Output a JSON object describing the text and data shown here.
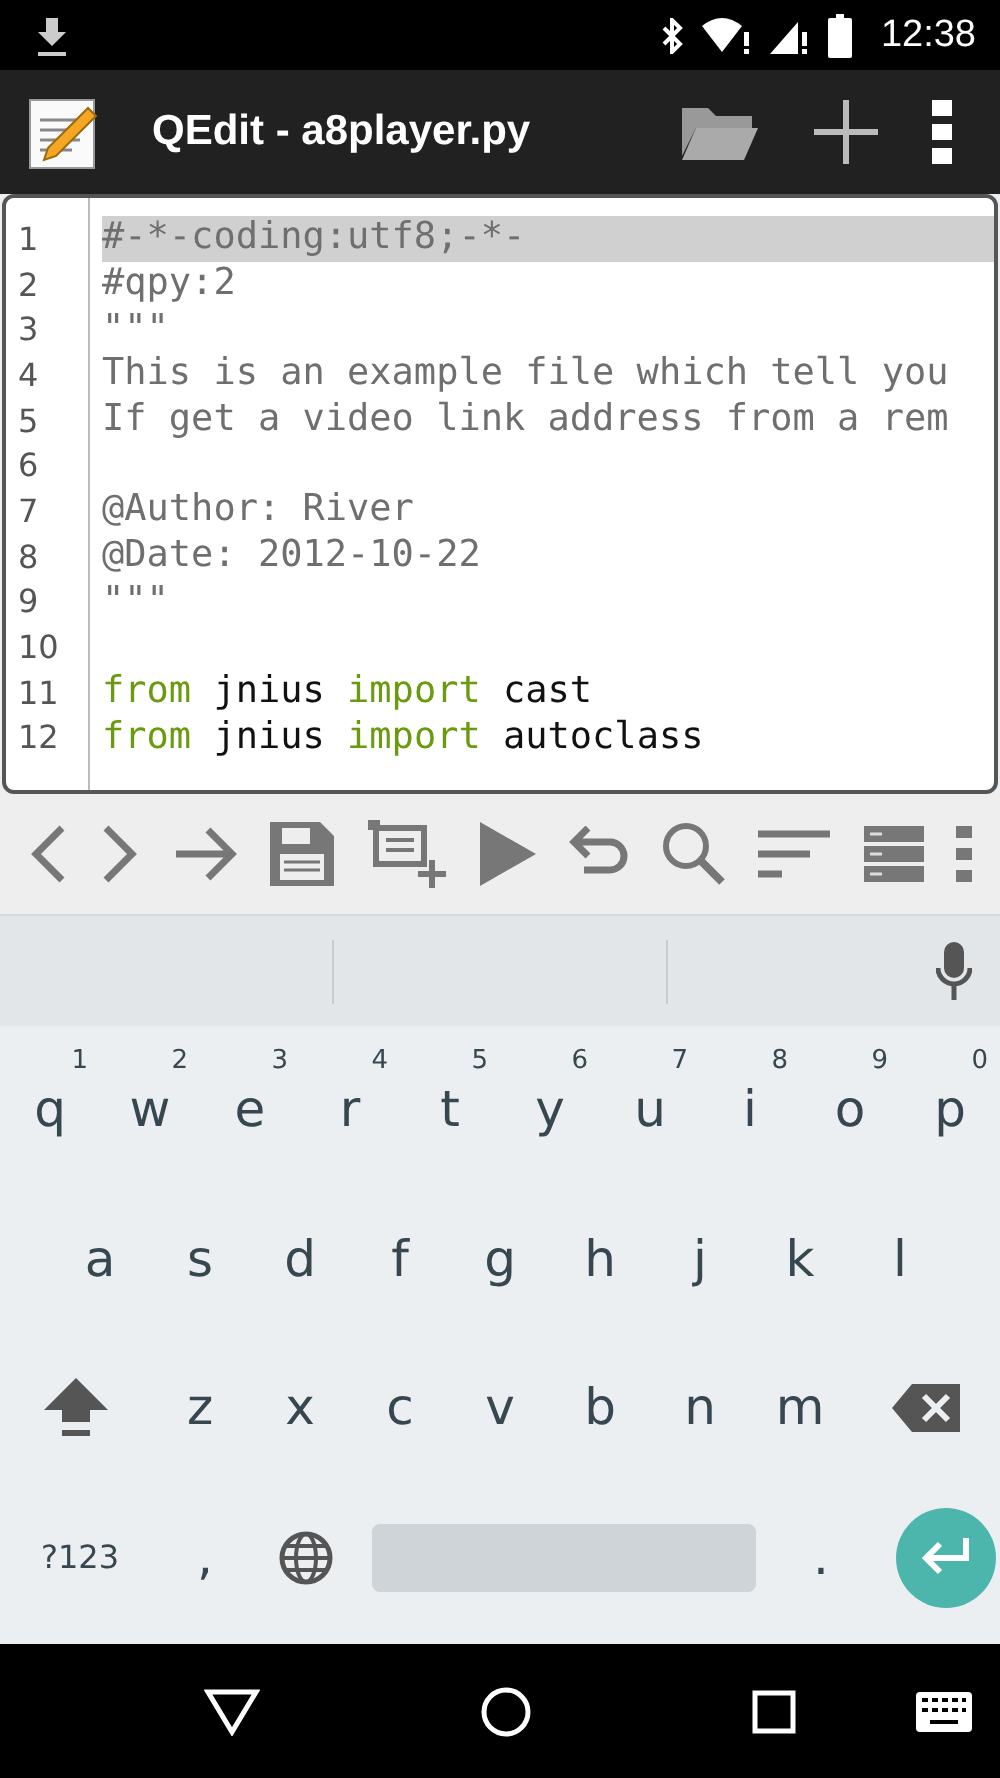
{
  "status_bar": {
    "time": "12:38"
  },
  "app_bar": {
    "title": "QEdit - a8player.py"
  },
  "editor": {
    "lines": [
      {
        "number": "1",
        "highlighted": true,
        "tokens": [
          {
            "text": "#-*-coding:utf8;-*-",
            "kind": "comment"
          }
        ]
      },
      {
        "number": "2",
        "highlighted": false,
        "tokens": [
          {
            "text": "#qpy:2",
            "kind": "comment"
          }
        ]
      },
      {
        "number": "3",
        "highlighted": false,
        "tokens": [
          {
            "text": "\"\"\"",
            "kind": "comment"
          }
        ]
      },
      {
        "number": "4",
        "highlighted": false,
        "tokens": [
          {
            "text": "This is an example file which tell you",
            "kind": "comment"
          }
        ]
      },
      {
        "number": "5",
        "highlighted": false,
        "tokens": [
          {
            "text": "If get a video link address from a rem",
            "kind": "comment"
          }
        ]
      },
      {
        "number": "6",
        "highlighted": false
      },
      {
        "number": "7",
        "highlighted": false,
        "tokens": [
          {
            "text": "@Author: River",
            "kind": "comment"
          }
        ]
      },
      {
        "number": "8",
        "highlighted": false,
        "tokens": [
          {
            "text": "@Date: 2012-10-22",
            "kind": "comment"
          }
        ]
      },
      {
        "number": "9",
        "highlighted": false,
        "tokens": [
          {
            "text": "\"\"\"",
            "kind": "comment"
          }
        ]
      },
      {
        "number": "10",
        "highlighted": false
      },
      {
        "number": "11",
        "highlighted": false,
        "tokens": [
          {
            "text": "from",
            "kind": "keyword"
          },
          {
            "text": " jnius ",
            "kind": "plain"
          },
          {
            "text": "import",
            "kind": "keyword"
          },
          {
            "text": " cast",
            "kind": "plain"
          }
        ]
      },
      {
        "number": "12",
        "highlighted": false,
        "tokens": [
          {
            "text": "from",
            "kind": "keyword"
          },
          {
            "text": " jnius ",
            "kind": "plain"
          },
          {
            "text": "import",
            "kind": "keyword"
          },
          {
            "text": " autoclass",
            "kind": "plain"
          }
        ]
      }
    ]
  },
  "keyboard": {
    "rows": [
      [
        {
          "label": "q",
          "hint": "1"
        },
        {
          "label": "w",
          "hint": "2"
        },
        {
          "label": "e",
          "hint": "3"
        },
        {
          "label": "r",
          "hint": "4"
        },
        {
          "label": "t",
          "hint": "5"
        },
        {
          "label": "y",
          "hint": "6"
        },
        {
          "label": "u",
          "hint": "7"
        },
        {
          "label": "i",
          "hint": "8"
        },
        {
          "label": "o",
          "hint": "9"
        },
        {
          "label": "p",
          "hint": "0"
        }
      ],
      [
        {
          "label": "a"
        },
        {
          "label": "s"
        },
        {
          "label": "d"
        },
        {
          "label": "f"
        },
        {
          "label": "g"
        },
        {
          "label": "h"
        },
        {
          "label": "j"
        },
        {
          "label": "k"
        },
        {
          "label": "l"
        }
      ],
      [
        {
          "label": "z"
        },
        {
          "label": "x"
        },
        {
          "label": "c"
        },
        {
          "label": "v"
        },
        {
          "label": "b"
        },
        {
          "label": "n"
        },
        {
          "label": "m"
        }
      ]
    ],
    "symbols_key": "?123",
    "comma_key": ",",
    "period_key": "."
  }
}
